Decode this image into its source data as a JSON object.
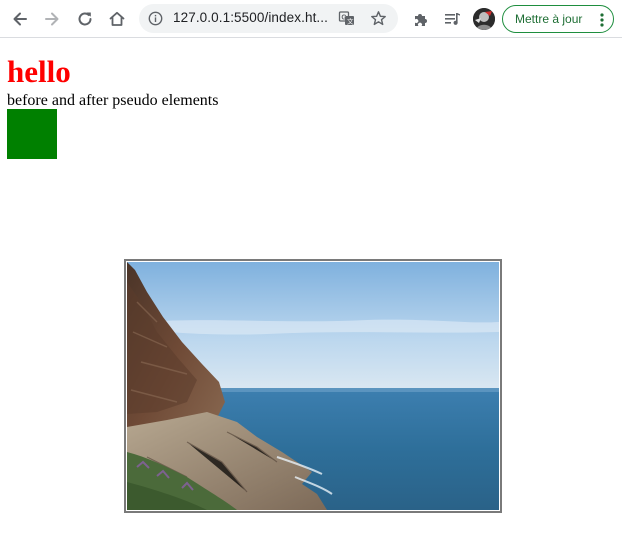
{
  "browser": {
    "url": "127.0.0.1:5500/index.ht...",
    "update_button_label": "Mettre à jour",
    "icons": {
      "back": "arrow-left-icon",
      "forward": "arrow-right-icon",
      "reload": "reload-icon",
      "home": "home-icon",
      "site_info": "info-icon",
      "translate": "translate-icon",
      "bookmark": "star-icon",
      "extensions": "puzzle-icon",
      "media": "playlist-icon",
      "profile": "avatar",
      "menu": "kebab-menu-icon"
    }
  },
  "page": {
    "heading": "hello",
    "heading_color": "#ff0000",
    "subtitle": "before and after pseudo elements",
    "box_color": "#008000",
    "image_description": "coastal cliff and sea landscape photo"
  }
}
